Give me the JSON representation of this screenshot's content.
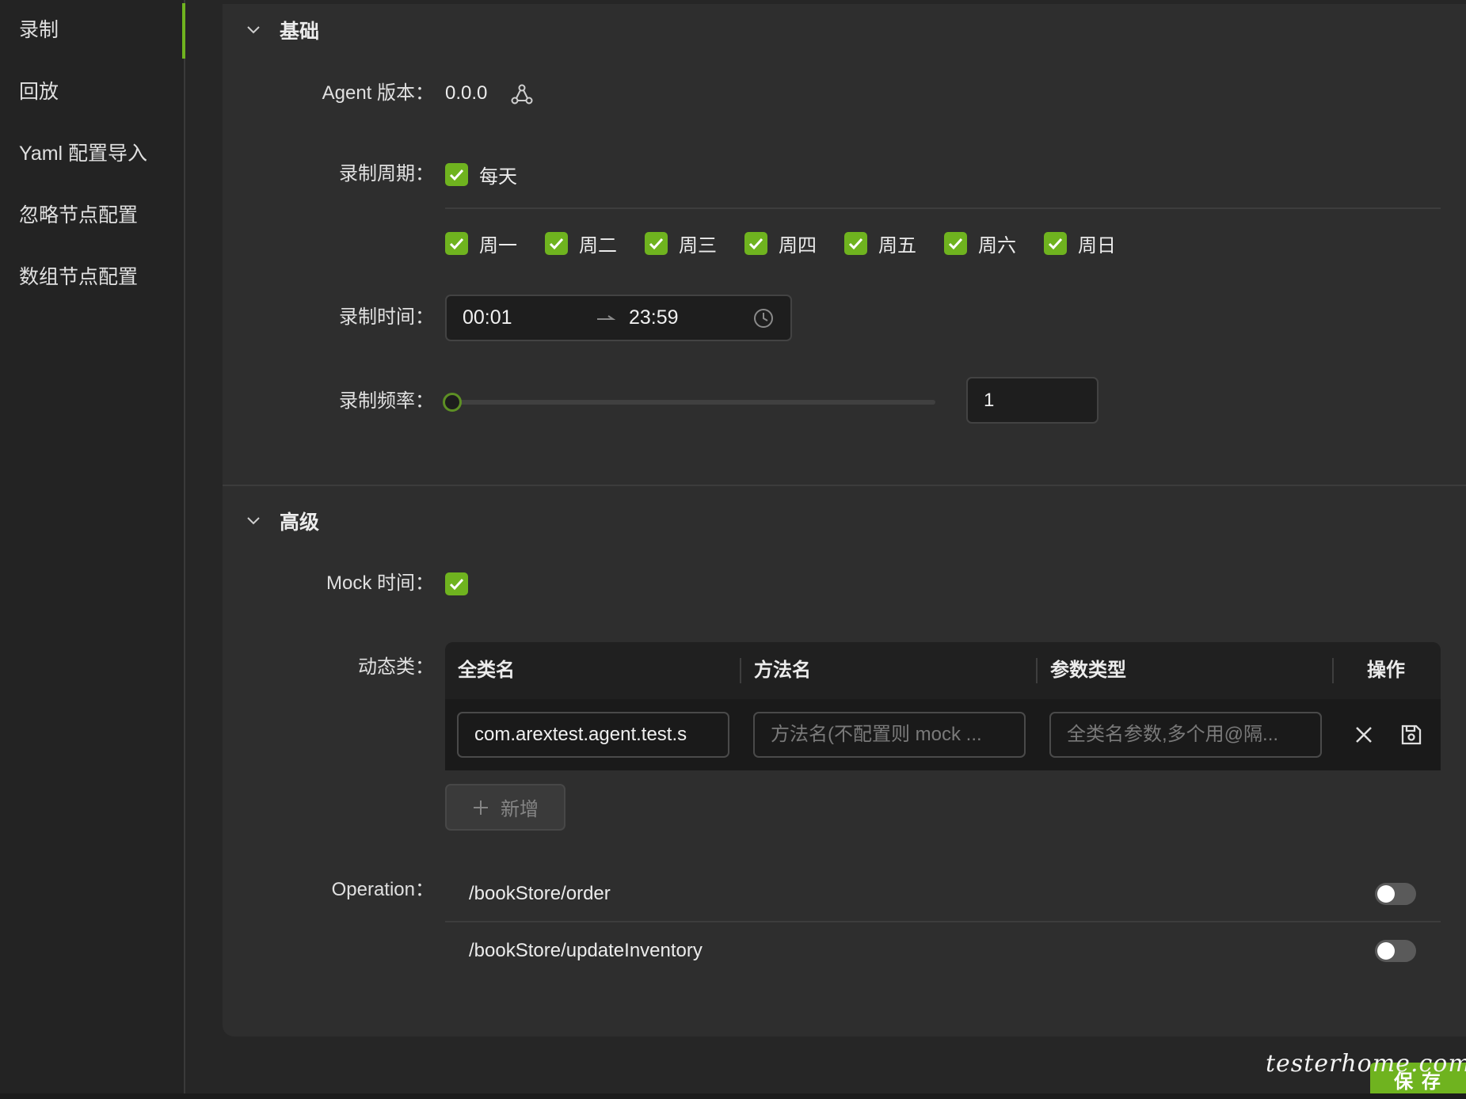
{
  "sidebar": {
    "items": [
      {
        "label": "录制"
      },
      {
        "label": "回放"
      },
      {
        "label": "Yaml 配置导入"
      },
      {
        "label": "忽略节点配置"
      },
      {
        "label": "数组节点配置"
      }
    ]
  },
  "basic": {
    "title": "基础",
    "agent_label": "Agent 版本：",
    "agent_version": "0.0.0",
    "cycle_label": "录制周期：",
    "everyday_label": "每天",
    "days": [
      "周一",
      "周二",
      "周三",
      "周四",
      "周五",
      "周六",
      "周日"
    ],
    "time_label": "录制时间：",
    "time_start": "00:01",
    "time_end": "23:59",
    "freq_label": "录制频率：",
    "freq_value": "1"
  },
  "advanced": {
    "title": "高级",
    "mock_label": "Mock 时间：",
    "dynamic_label": "动态类：",
    "table": {
      "headers": [
        "全类名",
        "方法名",
        "参数类型",
        "操作"
      ],
      "row": {
        "class_value": "com.arextest.agent.test.s",
        "method_placeholder": "方法名(不配置则 mock ...",
        "param_placeholder": "全类名参数,多个用@隔..."
      }
    },
    "add_label": "新增",
    "operation_label": "Operation：",
    "operations": [
      {
        "path": "/bookStore/order",
        "enabled": false
      },
      {
        "path": "/bookStore/updateInventory",
        "enabled": false
      }
    ]
  },
  "save_label": "保 存",
  "watermark": "testerhome.com",
  "colors": {
    "accent": "#6fb31f",
    "background": "#262626",
    "panel": "#2e2e2e"
  }
}
